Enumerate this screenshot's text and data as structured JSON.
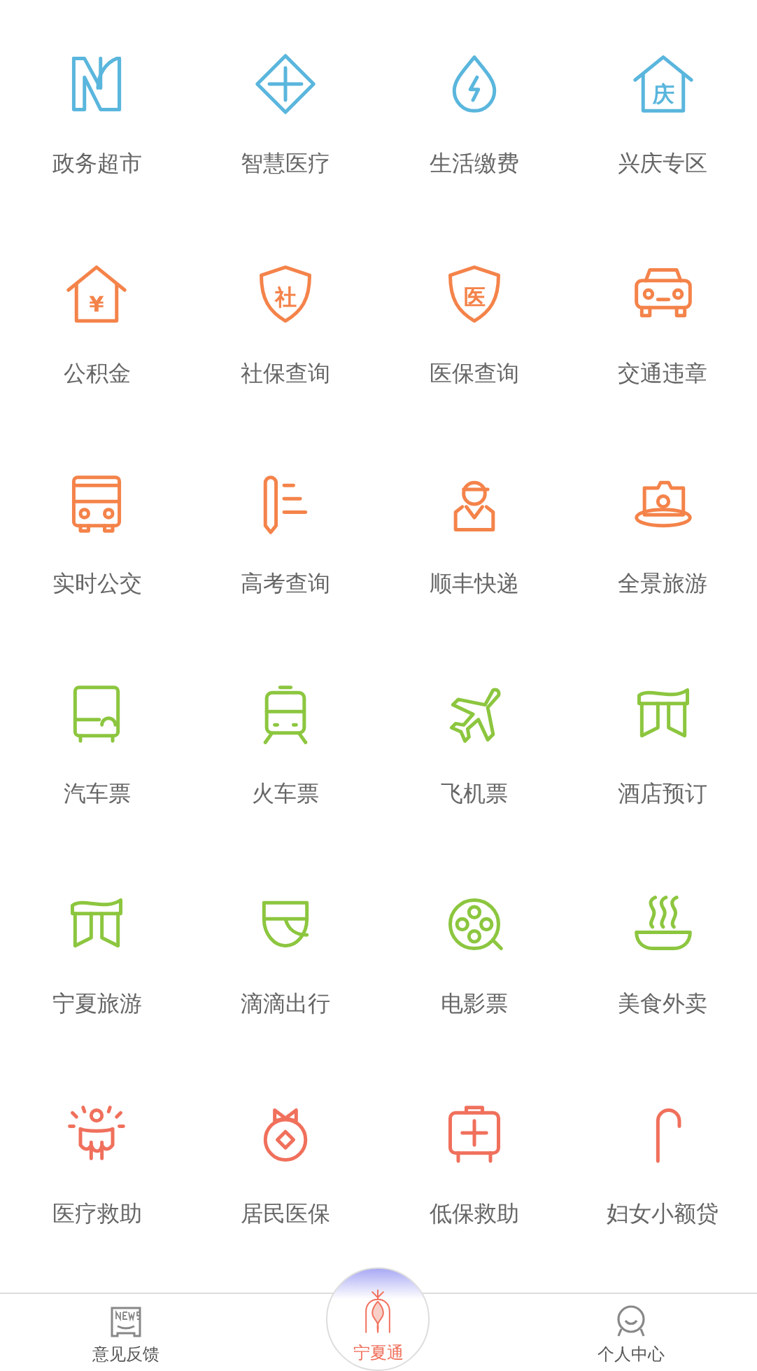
{
  "services": [
    {
      "label": "政务超市",
      "kind": "n-logo",
      "color": "#5ab6dd"
    },
    {
      "label": "智慧医疗",
      "kind": "diamond-plus",
      "color": "#5ab6dd"
    },
    {
      "label": "生活缴费",
      "kind": "drop",
      "color": "#5ab6dd"
    },
    {
      "label": "兴庆专区",
      "kind": "house",
      "glyph": "庆",
      "color": "#5ab6dd"
    },
    {
      "label": "公积金",
      "kind": "house",
      "glyph": "¥",
      "color": "#f4834a"
    },
    {
      "label": "社保查询",
      "kind": "shield",
      "glyph": "社",
      "color": "#f4834a"
    },
    {
      "label": "医保查询",
      "kind": "shield",
      "glyph": "医",
      "color": "#f4834a"
    },
    {
      "label": "交通违章",
      "kind": "car",
      "color": "#f4834a"
    },
    {
      "label": "实时公交",
      "kind": "bus",
      "color": "#f4834a"
    },
    {
      "label": "高考查询",
      "kind": "pencil",
      "color": "#f4834a"
    },
    {
      "label": "顺丰快递",
      "kind": "courier",
      "color": "#f4834a"
    },
    {
      "label": "全景旅游",
      "kind": "camera",
      "color": "#f4834a"
    },
    {
      "label": "汽车票",
      "kind": "coach",
      "color": "#8cc63f"
    },
    {
      "label": "火车票",
      "kind": "train",
      "color": "#8cc63f"
    },
    {
      "label": "飞机票",
      "kind": "plane",
      "color": "#8cc63f"
    },
    {
      "label": "酒店预订",
      "kind": "gate",
      "color": "#8cc63f"
    },
    {
      "label": "宁夏旅游",
      "kind": "gate",
      "color": "#8cc63f"
    },
    {
      "label": "滴滴出行",
      "kind": "bowl",
      "color": "#8cc63f"
    },
    {
      "label": "电影票",
      "kind": "reel",
      "color": "#8cc63f"
    },
    {
      "label": "美食外卖",
      "kind": "steam",
      "color": "#8cc63f"
    },
    {
      "label": "医疗救助",
      "kind": "person-rays",
      "color": "#f0705c"
    },
    {
      "label": "居民医保",
      "kind": "medal",
      "color": "#f0705c"
    },
    {
      "label": "低保救助",
      "kind": "kit",
      "color": "#f0705c"
    },
    {
      "label": "妇女小额贷",
      "kind": "cane",
      "color": "#f0705c"
    }
  ],
  "tabs": [
    {
      "label": "意见反馈",
      "kind": "news",
      "selected": false
    },
    {
      "label": "宁夏通",
      "kind": "center",
      "selected": true
    },
    {
      "label": "个人中心",
      "kind": "face",
      "selected": false
    }
  ]
}
